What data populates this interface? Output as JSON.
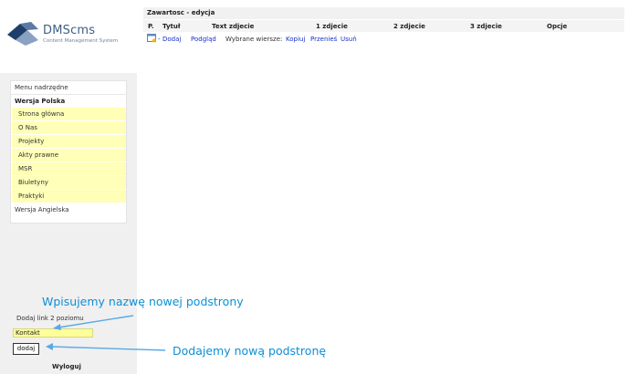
{
  "brand": {
    "name": "DMScms",
    "tagline": "Content Management System"
  },
  "sidebar": {
    "menu_top": "Menu nadrzędne",
    "section_pl": "Wersja Polska",
    "items": [
      "Strona główna",
      "O Nas",
      "Projekty",
      "Akty prawne",
      "MSR",
      "Biuletyny",
      "Praktyki"
    ],
    "section_en": "Wersja Angielska"
  },
  "add_form": {
    "label": "Dodaj link 2 poziomu",
    "input_value": "Kontakt",
    "button_label": "dodaj"
  },
  "logout_label": "Wyloguj",
  "main": {
    "title": "Zawartosc - edycja",
    "columns": [
      "P.",
      "Tytuł",
      "Text zdjecie",
      "1 zdjecie",
      "2 zdjecie",
      "3 zdjecie",
      "Opcje"
    ],
    "actions": {
      "add": "Dodaj",
      "preview": "Podgląd",
      "selected_rows": "Wybrane wiersze:",
      "copy": "Kopiuj",
      "move": "Przenieś",
      "delete": "Usuń"
    }
  },
  "annotations": {
    "name_hint": "Wpisujemy nazwę nowej podstrony",
    "add_hint": "Dodajemy nową podstronę"
  },
  "colors": {
    "annotation": "#0c8fd8",
    "link": "#1530c8",
    "highlight": "#ffffb8"
  }
}
